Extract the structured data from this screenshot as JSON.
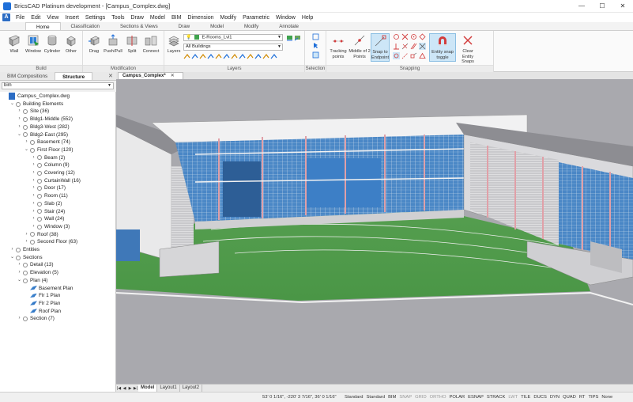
{
  "window": {
    "title": "BricsCAD Platinum development - [Campus_Complex.dwg]",
    "controls": [
      "—",
      "☐",
      "✕"
    ]
  },
  "menu": {
    "logo": "A",
    "items": [
      "File",
      "Edit",
      "View",
      "Insert",
      "Settings",
      "Tools",
      "Draw",
      "Model",
      "BIM",
      "Dimension",
      "Modify",
      "Parametric",
      "Window",
      "Help"
    ]
  },
  "ribbon_tabs": [
    "Home",
    "Classification",
    "Sections & Views",
    "Draw",
    "Model",
    "Modify",
    "Annotate"
  ],
  "ribbon": {
    "build": {
      "label": "Build",
      "buttons": [
        "Wall",
        "Window",
        "Cylinder",
        "Other"
      ]
    },
    "modification": {
      "label": "Modification",
      "buttons": [
        "Drag",
        "Push/Pull",
        "Split",
        "Connect"
      ]
    },
    "layers": {
      "label": "Layers",
      "button": "Layers",
      "layer_combo": "E-Rooms_Lvl1",
      "filter_combo": "All Buildings"
    },
    "selection": {
      "label": "Selection"
    },
    "snapping": {
      "label": "Snapping",
      "buttons": [
        "Tracking points",
        "Middle of 2 Points",
        "Snap to Endpoint",
        "Entity snap toggle",
        "Clear Entity Snaps"
      ]
    }
  },
  "panel": {
    "tabs": [
      "BIM Compositions",
      "Structure"
    ],
    "close": "✕",
    "combo": "bim",
    "tree": [
      {
        "label": "Campus_Complex.dwg",
        "level": 0,
        "chev": "",
        "icon": "doc"
      },
      {
        "label": "Building Elements",
        "level": 1,
        "chev": "v",
        "icon": "node"
      },
      {
        "label": "Site (36)",
        "level": 2,
        "chev": ">",
        "icon": "node"
      },
      {
        "label": "Bldg1-Middle (552)",
        "level": 2,
        "chev": ">",
        "icon": "node"
      },
      {
        "label": "Bldg3-West (282)",
        "level": 2,
        "chev": ">",
        "icon": "node"
      },
      {
        "label": "Bldg2-East (295)",
        "level": 2,
        "chev": "v",
        "icon": "node"
      },
      {
        "label": "Basement (74)",
        "level": 3,
        "chev": ">",
        "icon": "node"
      },
      {
        "label": "First Floor (120)",
        "level": 3,
        "chev": "v",
        "icon": "node"
      },
      {
        "label": "Beam (2)",
        "level": 4,
        "chev": ">",
        "icon": "node"
      },
      {
        "label": "Column (9)",
        "level": 4,
        "chev": ">",
        "icon": "node"
      },
      {
        "label": "Covering (12)",
        "level": 4,
        "chev": ">",
        "icon": "node"
      },
      {
        "label": "CurtainWall (16)",
        "level": 4,
        "chev": ">",
        "icon": "node"
      },
      {
        "label": "Door (17)",
        "level": 4,
        "chev": ">",
        "icon": "node"
      },
      {
        "label": "Room (11)",
        "level": 4,
        "chev": ">",
        "icon": "node"
      },
      {
        "label": "Slab (2)",
        "level": 4,
        "chev": ">",
        "icon": "node"
      },
      {
        "label": "Stair (24)",
        "level": 4,
        "chev": ">",
        "icon": "node"
      },
      {
        "label": "Wall (24)",
        "level": 4,
        "chev": ">",
        "icon": "node"
      },
      {
        "label": "Window (3)",
        "level": 4,
        "chev": ">",
        "icon": "node"
      },
      {
        "label": "Roof (38)",
        "level": 3,
        "chev": ">",
        "icon": "node"
      },
      {
        "label": "Second Floor (63)",
        "level": 3,
        "chev": ">",
        "icon": "node"
      },
      {
        "label": "Entities",
        "level": 1,
        "chev": ">",
        "icon": "node"
      },
      {
        "label": "Sections",
        "level": 1,
        "chev": "v",
        "icon": "node"
      },
      {
        "label": "Detail (13)",
        "level": 2,
        "chev": ">",
        "icon": "node"
      },
      {
        "label": "Elevation (5)",
        "level": 2,
        "chev": ">",
        "icon": "node"
      },
      {
        "label": "Plan (4)",
        "level": 2,
        "chev": "v",
        "icon": "node"
      },
      {
        "label": "Basement Plan",
        "level": 3,
        "chev": "",
        "icon": "plan"
      },
      {
        "label": "Flr 1 Plan",
        "level": 3,
        "chev": "",
        "icon": "plan"
      },
      {
        "label": "Flr 2 Plan",
        "level": 3,
        "chev": "",
        "icon": "plan"
      },
      {
        "label": "Roof Plan",
        "level": 3,
        "chev": "",
        "icon": "plan"
      },
      {
        "label": "Section (7)",
        "level": 2,
        "chev": ">",
        "icon": "node"
      }
    ]
  },
  "document_tab": {
    "label": "Campus_Complex*",
    "close": "✕"
  },
  "layout_tabs": [
    "Model",
    "Layout1",
    "Layout2"
  ],
  "layout_nav": [
    "|◀",
    "◀",
    "▶",
    "▶|"
  ],
  "status": {
    "coords": "53' 0 1/16\", -220' 3 7/16\", 36' 0 1/16\"",
    "toggles": [
      {
        "label": "Standard",
        "on": true
      },
      {
        "label": "Standard",
        "on": true
      },
      {
        "label": "BIM",
        "on": true
      },
      {
        "label": "SNAP",
        "on": false
      },
      {
        "label": "GRID",
        "on": false
      },
      {
        "label": "ORTHO",
        "on": false
      },
      {
        "label": "POLAR",
        "on": true
      },
      {
        "label": "ESNAP",
        "on": true
      },
      {
        "label": "STRACK",
        "on": true
      },
      {
        "label": "LWT",
        "on": false
      },
      {
        "label": "TILE",
        "on": true
      },
      {
        "label": "DUCS",
        "on": true
      },
      {
        "label": "DYN",
        "on": true
      },
      {
        "label": "QUAD",
        "on": true
      },
      {
        "label": "RT",
        "on": true
      },
      {
        "label": "TIPS",
        "on": true
      },
      {
        "label": "None",
        "on": true
      }
    ]
  },
  "colors": {
    "accent": "#1e6fd9",
    "grass": "#4e9a4a",
    "glass": "#3f7fc2",
    "background": "#a9a9ae"
  }
}
